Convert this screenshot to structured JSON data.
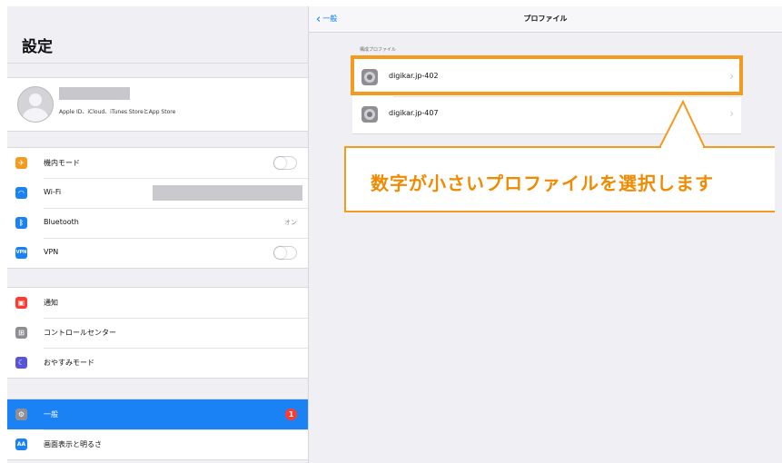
{
  "sidebar": {
    "title": "設定",
    "profile": {
      "subtitle": "Apple ID、iCloud、iTunes StoreとApp Store"
    },
    "group1": [
      {
        "label": "機内モード",
        "icon": "airplane-icon",
        "color": "#f39a1f",
        "control": "toggle"
      },
      {
        "label": "Wi-Fi",
        "icon": "wifi-icon",
        "color": "#1a82f5",
        "control": "wifi"
      },
      {
        "label": "Bluetooth",
        "icon": "bluetooth-icon",
        "color": "#1a82f5",
        "value": "オン"
      },
      {
        "label": "VPN",
        "icon": "vpn-icon",
        "color": "#1a82f5",
        "control": "toggle"
      }
    ],
    "group2": [
      {
        "label": "通知",
        "icon": "notifications-icon",
        "color": "#ff3b30"
      },
      {
        "label": "コントロールセンター",
        "icon": "control-center-icon",
        "color": "#8e8e93"
      },
      {
        "label": "おやすみモード",
        "icon": "do-not-disturb-icon",
        "color": "#5856d6"
      }
    ],
    "group3": [
      {
        "label": "一般",
        "icon": "general-gear-icon",
        "color": "#8e8e93",
        "selected": true,
        "badge": "1"
      },
      {
        "label": "画面表示と明るさ",
        "icon": "display-brightness-icon",
        "color": "#1a82f5",
        "glyph": "AA"
      }
    ]
  },
  "navbar": {
    "back_label": "一般",
    "title": "プロファイル"
  },
  "profiles": {
    "section_header": "構成プロファイル",
    "items": [
      {
        "label": "digikar.jp-402",
        "highlighted": true
      },
      {
        "label": "digikar.jp-407",
        "highlighted": false
      }
    ]
  },
  "annotation": {
    "text": "数字が小さいプロファイルを選択します",
    "color": "#f39a1f"
  }
}
